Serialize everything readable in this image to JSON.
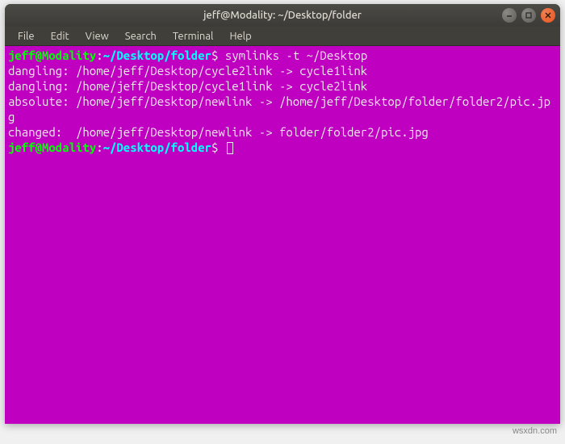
{
  "window": {
    "title": "jeff@Modality: ~/Desktop/folder"
  },
  "menubar": {
    "items": [
      "File",
      "Edit",
      "View",
      "Search",
      "Terminal",
      "Help"
    ]
  },
  "prompt": {
    "user_host": "jeff@Modality",
    "sep1": ":",
    "path": "~/Desktop/folder",
    "sep2": "$"
  },
  "terminal": {
    "command": "symlinks -t ~/Desktop",
    "lines": [
      "dangling: /home/jeff/Desktop/cycle2link -> cycle1link",
      "dangling: /home/jeff/Desktop/cycle1link -> cycle2link",
      "absolute: /home/jeff/Desktop/newlink -> /home/jeff/Desktop/folder/folder2/pic.jpg",
      "changed:  /home/jeff/Desktop/newlink -> folder/folder2/pic.jpg"
    ]
  },
  "watermark": "wsxdn.com"
}
